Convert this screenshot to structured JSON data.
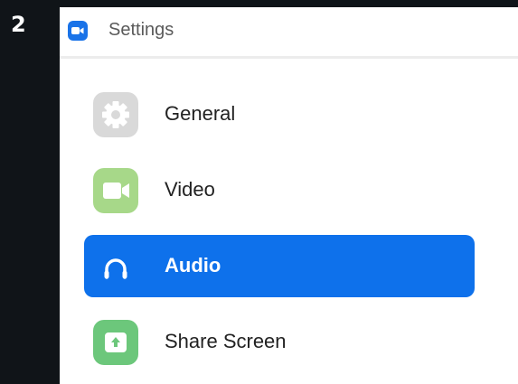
{
  "step": {
    "number": "2"
  },
  "window": {
    "title": "Settings"
  },
  "colors": {
    "accent": "#0e71eb",
    "general_icon": "#d9d9d9",
    "video_icon": "#a7d889",
    "share_icon": "#6cc77b"
  },
  "sidebar": {
    "items": [
      {
        "label": "General",
        "icon": "gear-icon",
        "selected": false
      },
      {
        "label": "Video",
        "icon": "video-camera-icon",
        "selected": false
      },
      {
        "label": "Audio",
        "icon": "headphones-icon",
        "selected": true
      },
      {
        "label": "Share Screen",
        "icon": "share-screen-icon",
        "selected": false
      }
    ]
  }
}
